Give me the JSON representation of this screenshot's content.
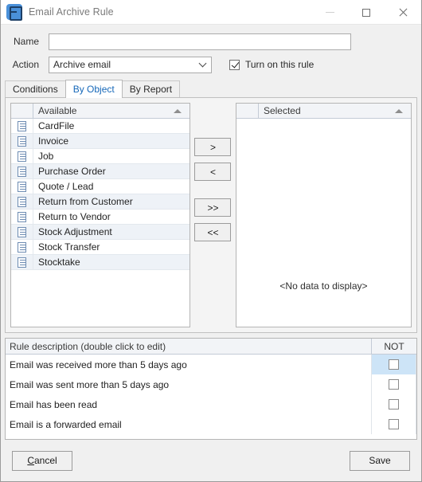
{
  "window": {
    "title": "Email Archive Rule",
    "icon": "email-rule-icon",
    "controls": {
      "minimize": "minimize-icon",
      "maximize": "maximize-icon",
      "close": "close-icon"
    }
  },
  "form": {
    "name_label": "Name",
    "name_value": "",
    "name_placeholder": "",
    "action_label": "Action",
    "action_value": "Archive email",
    "action_options": [
      "Archive email"
    ],
    "turn_on_label": "Turn on this rule",
    "turn_on_checked": true
  },
  "tabs": [
    {
      "label": "Conditions",
      "active": false
    },
    {
      "label": "By Object",
      "active": true
    },
    {
      "label": "By Report",
      "active": false
    }
  ],
  "available": {
    "header": "Available",
    "sort": "ascending",
    "items": [
      "CardFile",
      "Invoice",
      "Job",
      "Purchase Order",
      "Quote / Lead",
      "Return from Customer",
      "Return to Vendor",
      "Stock Adjustment",
      "Stock Transfer",
      "Stocktake"
    ]
  },
  "transfer_buttons": [
    {
      "label": ">",
      "name": "move-right-button"
    },
    {
      "label": "<",
      "name": "move-left-button"
    },
    {
      "label": ">>",
      "name": "move-all-right-button"
    },
    {
      "label": "<<",
      "name": "move-all-left-button"
    }
  ],
  "selected": {
    "header": "Selected",
    "sort": "ascending",
    "items": [],
    "empty_text": "<No data to display>"
  },
  "rule_grid": {
    "desc_header": "Rule description (double click to edit)",
    "not_header": "NOT",
    "rows": [
      {
        "description": "Email was received more than 5 days ago",
        "not": false,
        "selected": true
      },
      {
        "description": "Email was sent more than 5 days ago",
        "not": false,
        "selected": false
      },
      {
        "description": "Email has been read",
        "not": false,
        "selected": false
      },
      {
        "description": "Email is a forwarded email",
        "not": false,
        "selected": false
      }
    ]
  },
  "footer": {
    "cancel_label": "Cancel",
    "cancel_accel": "C",
    "cancel_rest": "ancel",
    "save_label": "Save"
  },
  "colors": {
    "accent": "#1668b9",
    "selection": "#cde4f7",
    "grid_header": "#f2f4f7",
    "row_alt": "#eef2f7",
    "icon_blue": "#4a90d9"
  }
}
